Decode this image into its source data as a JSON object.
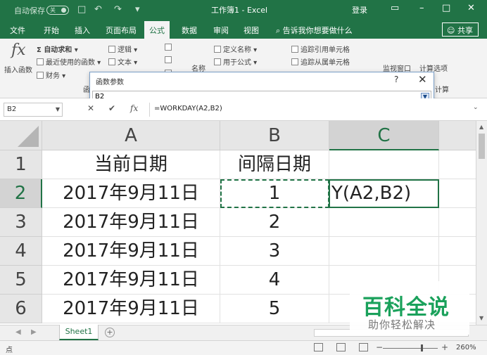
{
  "titlebar": {
    "autosave": "自动保存",
    "autosave_state": "关",
    "qat": [
      "□",
      "↶",
      "↷",
      "▾"
    ],
    "title": "工作簿1 - Excel",
    "login": "登录",
    "controls": [
      "▭",
      "–",
      "□",
      "✕"
    ]
  },
  "tabs": [
    "文件",
    "开始",
    "插入",
    "页面布局",
    "公式",
    "数据",
    "审阅",
    "视图"
  ],
  "active_tab": "公式",
  "tellme": "⌕ 告诉我你想要做什么",
  "share": "☺ 共享",
  "ribbon": {
    "insert_function_icon": "fx",
    "insert_function": "插入函数",
    "autosum": "Σ 自动求和 ▾",
    "recent": "最近使用的函数 ▾",
    "finance": "财务 ▾",
    "logic": "逻辑 ▾",
    "text": "文本 ▾",
    "group_label_left": "函",
    "define_name": "定义名称 ▾",
    "use_in_formula": "用于公式 ▾",
    "name_label": "名称",
    "trace_prec": "追踪引用单元格",
    "trace_dep": "追踪从属单元格",
    "watch": "监视窗口",
    "calc_options": "计算选项",
    "calc_label": "计算"
  },
  "dialog": {
    "title": "函数参数",
    "help": "?",
    "close": "✕",
    "input_value": "B2",
    "collapse": "▼"
  },
  "formula_bar": {
    "name_box": "B2",
    "cancel": "✕",
    "enter": "✔",
    "fx": "fx",
    "formula": "=WORKDAY(A2,B2)"
  },
  "sheet": {
    "columns": [
      "A",
      "B",
      "C"
    ],
    "rows": [
      {
        "num": "1",
        "a": "当前日期",
        "b": "间隔日期",
        "c": ""
      },
      {
        "num": "2",
        "a": "2017年9月11日",
        "b": "1",
        "c": "Y(A2,B2)"
      },
      {
        "num": "3",
        "a": "2017年9月11日",
        "b": "2",
        "c": ""
      },
      {
        "num": "4",
        "a": "2017年9月11日",
        "b": "3",
        "c": ""
      },
      {
        "num": "5",
        "a": "2017年9月11日",
        "b": "4",
        "c": ""
      },
      {
        "num": "6",
        "a": "2017年9月11日",
        "b": "5",
        "c": ""
      }
    ]
  },
  "sheet_tabs": {
    "tab": "Sheet1",
    "add": "+"
  },
  "statusbar": {
    "mode": "点",
    "zoom": "260%"
  },
  "watermark": {
    "title": "百科全说",
    "subtitle": "助你轻松解决"
  },
  "colors": {
    "accent": "#217346",
    "watermark": "#1aa15b"
  }
}
